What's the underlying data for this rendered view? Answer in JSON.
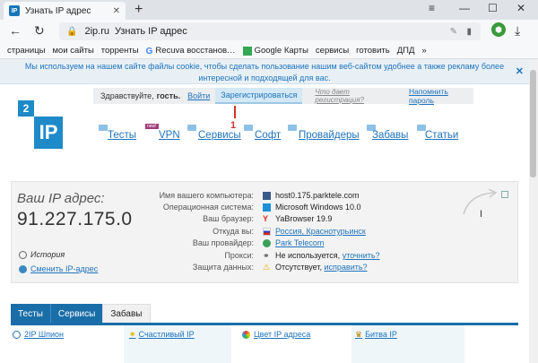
{
  "browser": {
    "tab_title": "Узнать IP адрес",
    "favicon_text": "IP",
    "url_domain": "2ip.ru",
    "url_title": "Узнать IP адрес",
    "bookmarks": [
      "страницы",
      "мои сайты",
      "торренты",
      "Recuva восстанов…",
      "Google Карты",
      "сервисы",
      "готовить",
      "ДПД"
    ],
    "bookmarks_more": "»"
  },
  "cookie": {
    "text": "Мы используем на нашем сайте файлы cookie, чтобы сделать пользование нашим веб-сайтом удобнее а также рекламу более интересной и подходящей для вас."
  },
  "login": {
    "greeting": "Здравствуйте,",
    "guest": "гость.",
    "login_link": "Войти",
    "register": "Зарегистрироваться",
    "why_register": "Что дает регистрация?",
    "remind": "Напомнить пароль"
  },
  "logo": {
    "small": "2",
    "big": "IP"
  },
  "annotation": "1",
  "nav": {
    "items": [
      "Тесты",
      "VPN",
      "Сервисы",
      "Софт",
      "Провайдеры",
      "Забавы",
      "Статьи"
    ],
    "vpn_badge": "new!"
  },
  "ip": {
    "caption": "Ваш IP адрес:",
    "value": "91.227.175.0",
    "history": "История",
    "change": "Сменить IP-адрес"
  },
  "info": [
    {
      "label": "Имя вашего компьютера:",
      "value": "host0.175.parktele.com",
      "link": false
    },
    {
      "label": "Операционная система:",
      "value": "Microsoft Windows 10.0",
      "link": false
    },
    {
      "label": "Ваш браузер:",
      "value": "YaBrowser 19.9",
      "link": false
    },
    {
      "label": "Откуда вы:",
      "value": "Россия, Краснотурьинск",
      "link": true
    },
    {
      "label": "Ваш провайдер:",
      "value": "Park Telecom",
      "link": true
    },
    {
      "label": "Прокси:",
      "value": "Не используется,",
      "extra": "уточнить?"
    },
    {
      "label": "Защита данных:",
      "value": "Отсутствует,",
      "extra": "исправить?"
    }
  ],
  "tabs": [
    "Тесты",
    "Сервисы",
    "Забавы"
  ],
  "services": [
    "2IP Шпион",
    "Счастливый IP",
    "Цвет IP адреса",
    "Битва IP"
  ],
  "colors": {
    "brand_blue": "#1e8ac8",
    "link_blue": "#1e73be",
    "tab_blue": "#1a6ea8",
    "accent_red": "#d2322d"
  }
}
